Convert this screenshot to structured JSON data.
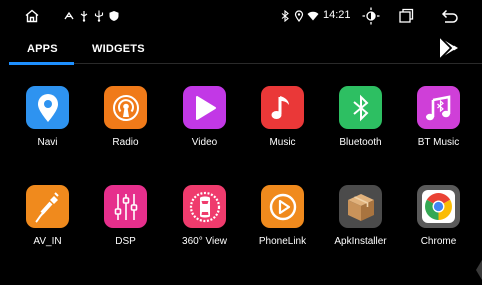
{
  "status_bar": {
    "time": "14:21",
    "icons": [
      "home-icon",
      "usb-icon",
      "usb-alt-icon",
      "shield-icon",
      "bluetooth-icon",
      "location-icon",
      "wifi-icon",
      "brightness-icon",
      "recent-apps-icon",
      "back-icon"
    ]
  },
  "tabs": [
    {
      "label": "APPS",
      "active": true
    },
    {
      "label": "WIDGETS",
      "active": false
    }
  ],
  "accent_color": "#1e90ff",
  "apps": [
    {
      "label": "Navi",
      "icon": "location-pin-icon",
      "color": "#2e93f0"
    },
    {
      "label": "Radio",
      "icon": "radio-icon",
      "color": "#f07a19"
    },
    {
      "label": "Video",
      "icon": "play-icon",
      "color": "#c238e6"
    },
    {
      "label": "Music",
      "icon": "music-note-icon",
      "color": "#ea3838"
    },
    {
      "label": "Bluetooth",
      "icon": "bluetooth-icon",
      "color": "#2dbf62"
    },
    {
      "label": "BT Music",
      "icon": "bt-music-icon",
      "color": "#cf3fd8"
    },
    {
      "label": "AV_IN",
      "icon": "av-cable-icon",
      "color": "#f08a1d"
    },
    {
      "label": "DSP",
      "icon": "equalizer-icon",
      "color": "#e62f8c"
    },
    {
      "label": "360° View",
      "icon": "car-360-icon",
      "color": "#ef3b6d"
    },
    {
      "label": "PhoneLink",
      "icon": "phonelink-play-icon",
      "color": "#f08a1d"
    },
    {
      "label": "ApkInstaller",
      "icon": "package-box-icon",
      "color": "#4b4b4b"
    },
    {
      "label": "Chrome",
      "icon": "chrome-icon",
      "color": "#5a5a5a"
    }
  ]
}
